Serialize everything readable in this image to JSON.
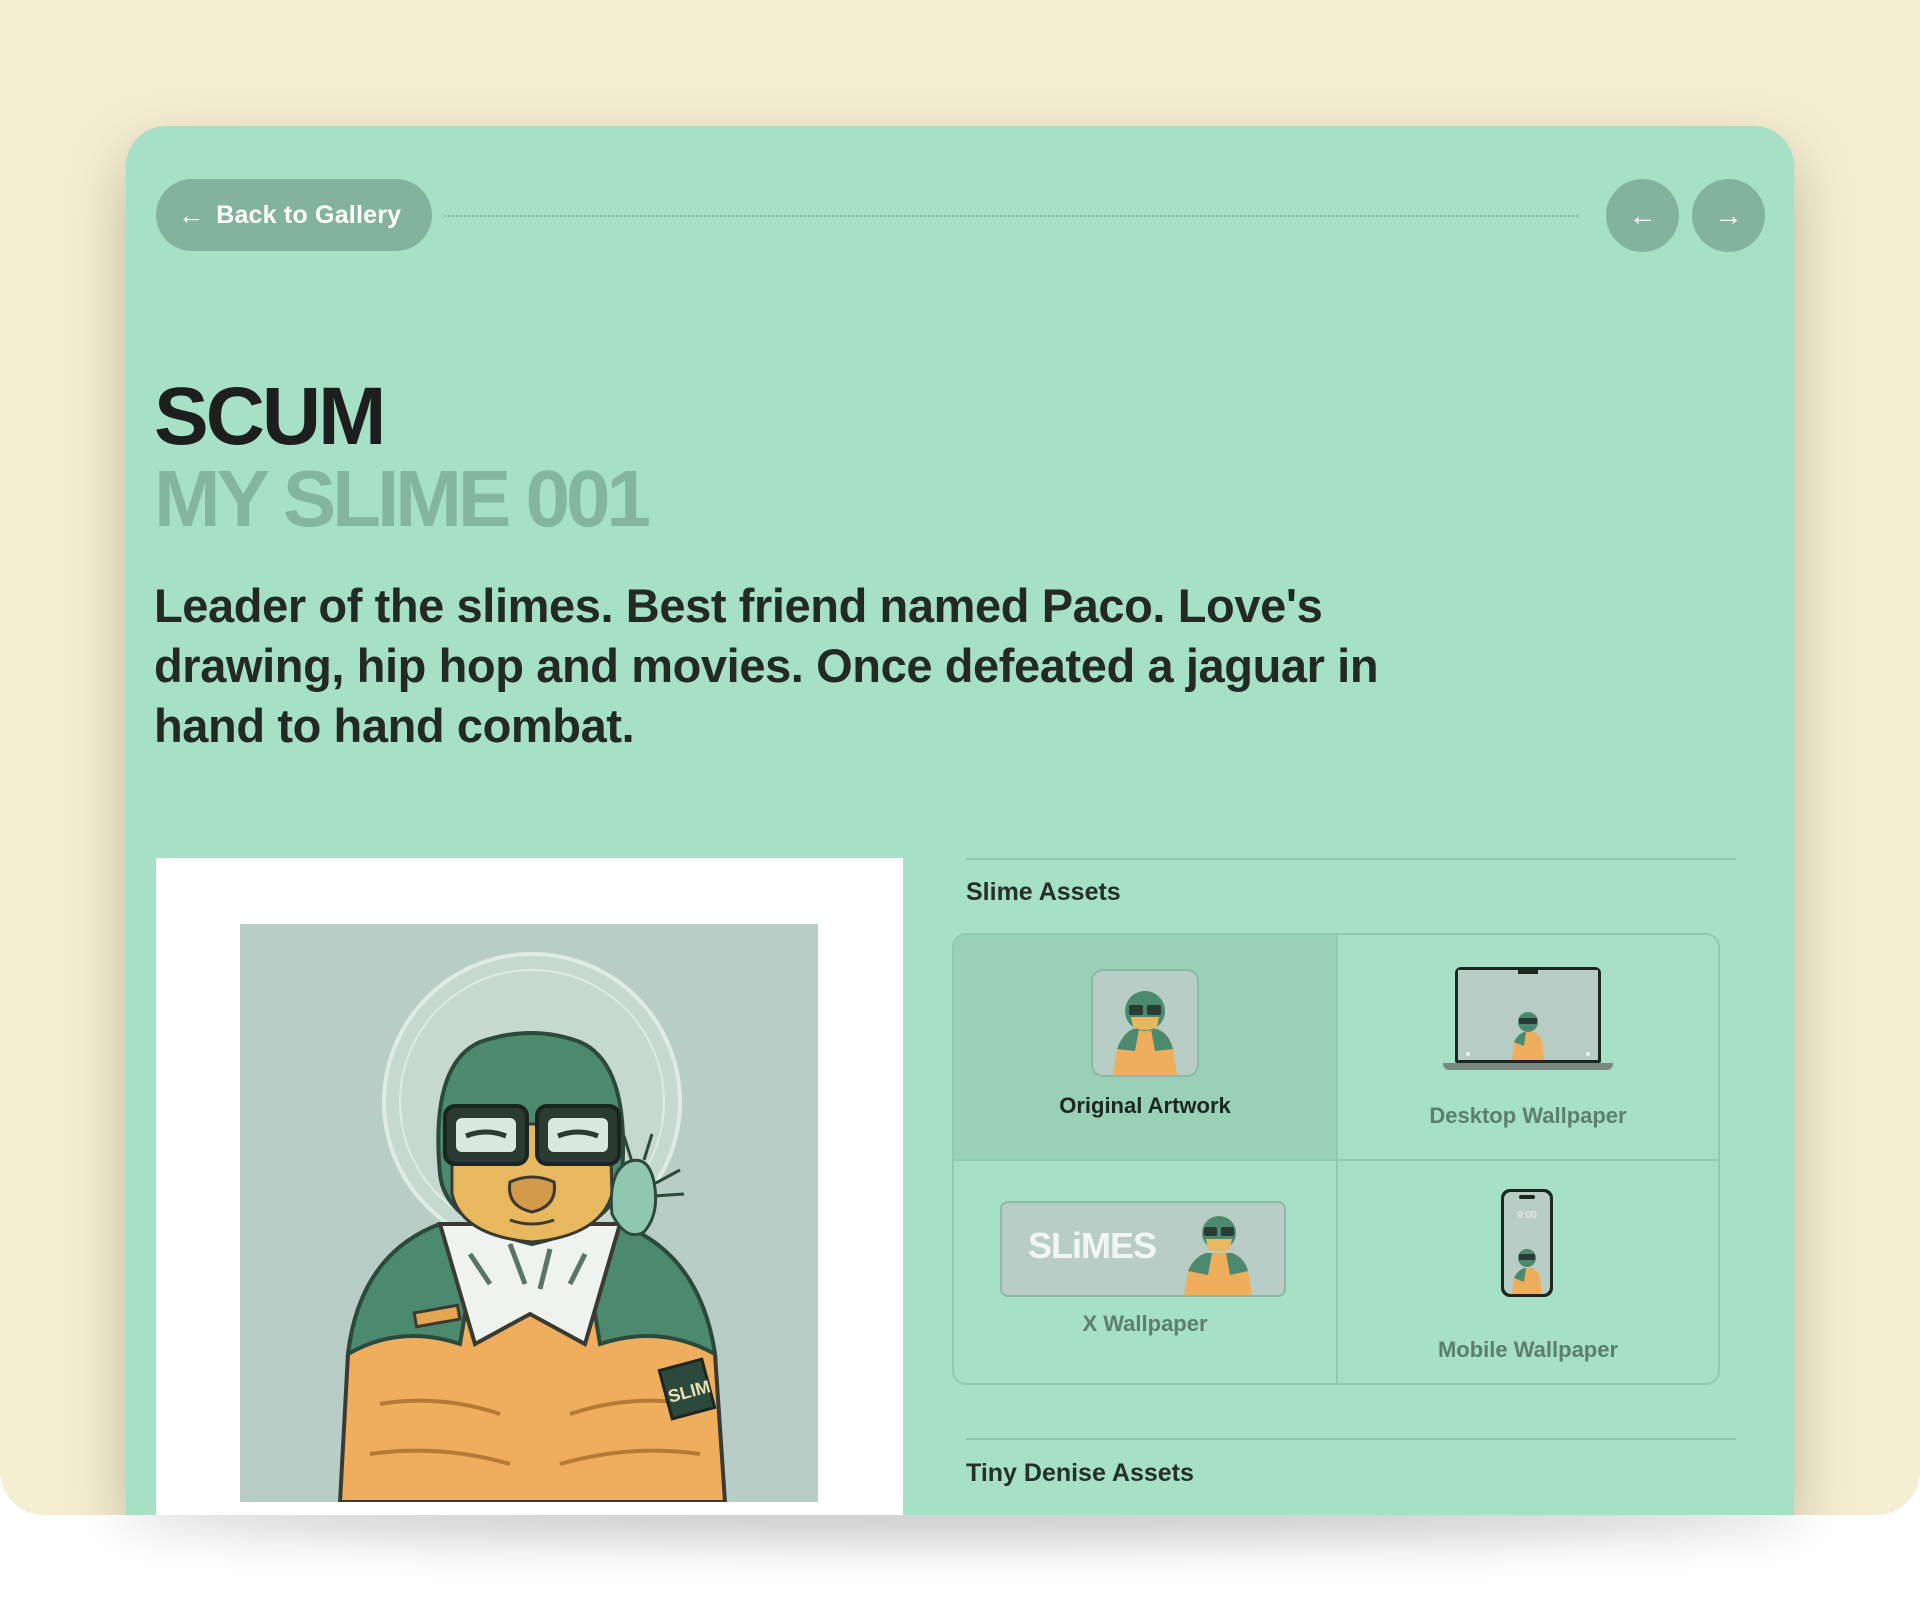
{
  "nav": {
    "back_label": "Back to Gallery",
    "back_arrow": "←",
    "prev_arrow": "←",
    "next_arrow": "→"
  },
  "character": {
    "title": "SCUM",
    "subtitle": "MY SLIME 001",
    "description": "Leader of the slimes. Best friend named Paco. Love's drawing, hip hop and movies. Once defeated a jaguar in hand to hand combat."
  },
  "assets": {
    "slime_title": "Slime Assets",
    "items": [
      {
        "label": "Original Artwork",
        "active": true
      },
      {
        "label": "Desktop Wallpaper",
        "active": false
      },
      {
        "label": "X Wallpaper",
        "active": false
      },
      {
        "label": "Mobile Wallpaper",
        "active": false
      }
    ],
    "x_banner_text": "SLiMES",
    "phone_time": "9:00",
    "tiny_title": "Tiny Denise Assets"
  },
  "artwork": {
    "patch_text": "SLIM"
  },
  "colors": {
    "page_bg": "#f6eed3",
    "card_bg": "#a6e0c6",
    "button_bg": "#83b39e",
    "muted_text": "#84b59f",
    "jacket_green": "#4c8a70",
    "jacket_orange": "#eeae5e"
  }
}
